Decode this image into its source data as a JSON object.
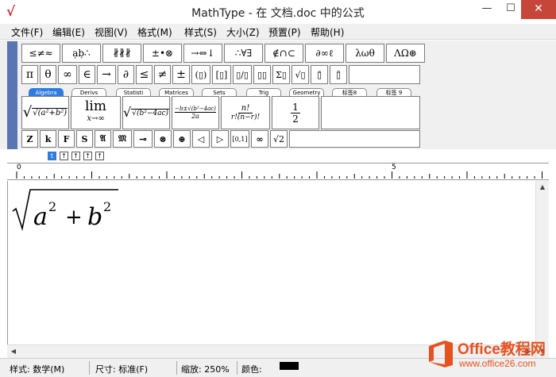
{
  "window": {
    "title": "MathType - 在 文档.doc 中的公式",
    "app_icon": "√",
    "min": "—",
    "max": "☐",
    "close": "✕"
  },
  "menu": [
    "文件(F)",
    "编辑(E)",
    "视图(V)",
    "格式(M)",
    "样式(S)",
    "大小(Z)",
    "预置(P)",
    "帮助(H)"
  ],
  "toolbar": {
    "row1": [
      "≤≠≈",
      "ạḅ∴",
      "∦∦∦",
      "±•⊗",
      "→⇔↓",
      "∴∀∃",
      "∉∩⊂",
      "∂∞ℓ",
      "λωθ",
      "ΛΩ⊛"
    ],
    "row2": [
      "π",
      "θ",
      "∞",
      "∈",
      "→",
      "∂",
      "≤",
      "≠",
      "±",
      "(▯)",
      "[▯]",
      "▯/▯",
      "▯▯",
      "Σ▯",
      "√▯",
      "▯̄",
      "▯̃"
    ],
    "tabs": [
      "Algebra",
      "Derivs",
      "Statisti",
      "Matrices",
      "Sets",
      "Trig",
      "Geometry",
      "标签8",
      "标签 9"
    ],
    "templates": {
      "sqrt_sum": "√(a²+b²)",
      "lim": "lim",
      "lim_sub": "x→∞",
      "discriminant": "√(b²−4ac)",
      "quadratic_num": "−b±√(b²−4ac)",
      "quadratic_den": "2a",
      "comb_num": "n!",
      "comb_den": "r!(n−r)!",
      "half_num": "1",
      "half_den": "2"
    },
    "row5": [
      "Z",
      "k",
      "F",
      "S",
      "𝔄",
      "𝔐",
      "⊸",
      "⊗",
      "⊕",
      "◁",
      "▷",
      "[0,1]",
      "∞",
      "√2"
    ]
  },
  "size_buttons": [
    "t",
    "↑",
    "↑",
    "↑",
    "↑"
  ],
  "ruler": {
    "mark0": "0",
    "mark5": "5"
  },
  "formula": {
    "base_a": "a",
    "exp_a": "2",
    "plus": "+",
    "base_b": "b",
    "exp_b": "2"
  },
  "status": {
    "style": "样式: 数学(M)",
    "size": "尺寸: 标准(F)",
    "zoom": "缩放: 250%",
    "color_label": "颜色:"
  },
  "watermark": {
    "brand": "Office教程网",
    "url": "www.office26.com"
  },
  "colors": {
    "accent": "#2f7ce0",
    "close_btn": "#c7463a",
    "watermark": "#e8501e",
    "tb_grip": "#5a76b2"
  }
}
